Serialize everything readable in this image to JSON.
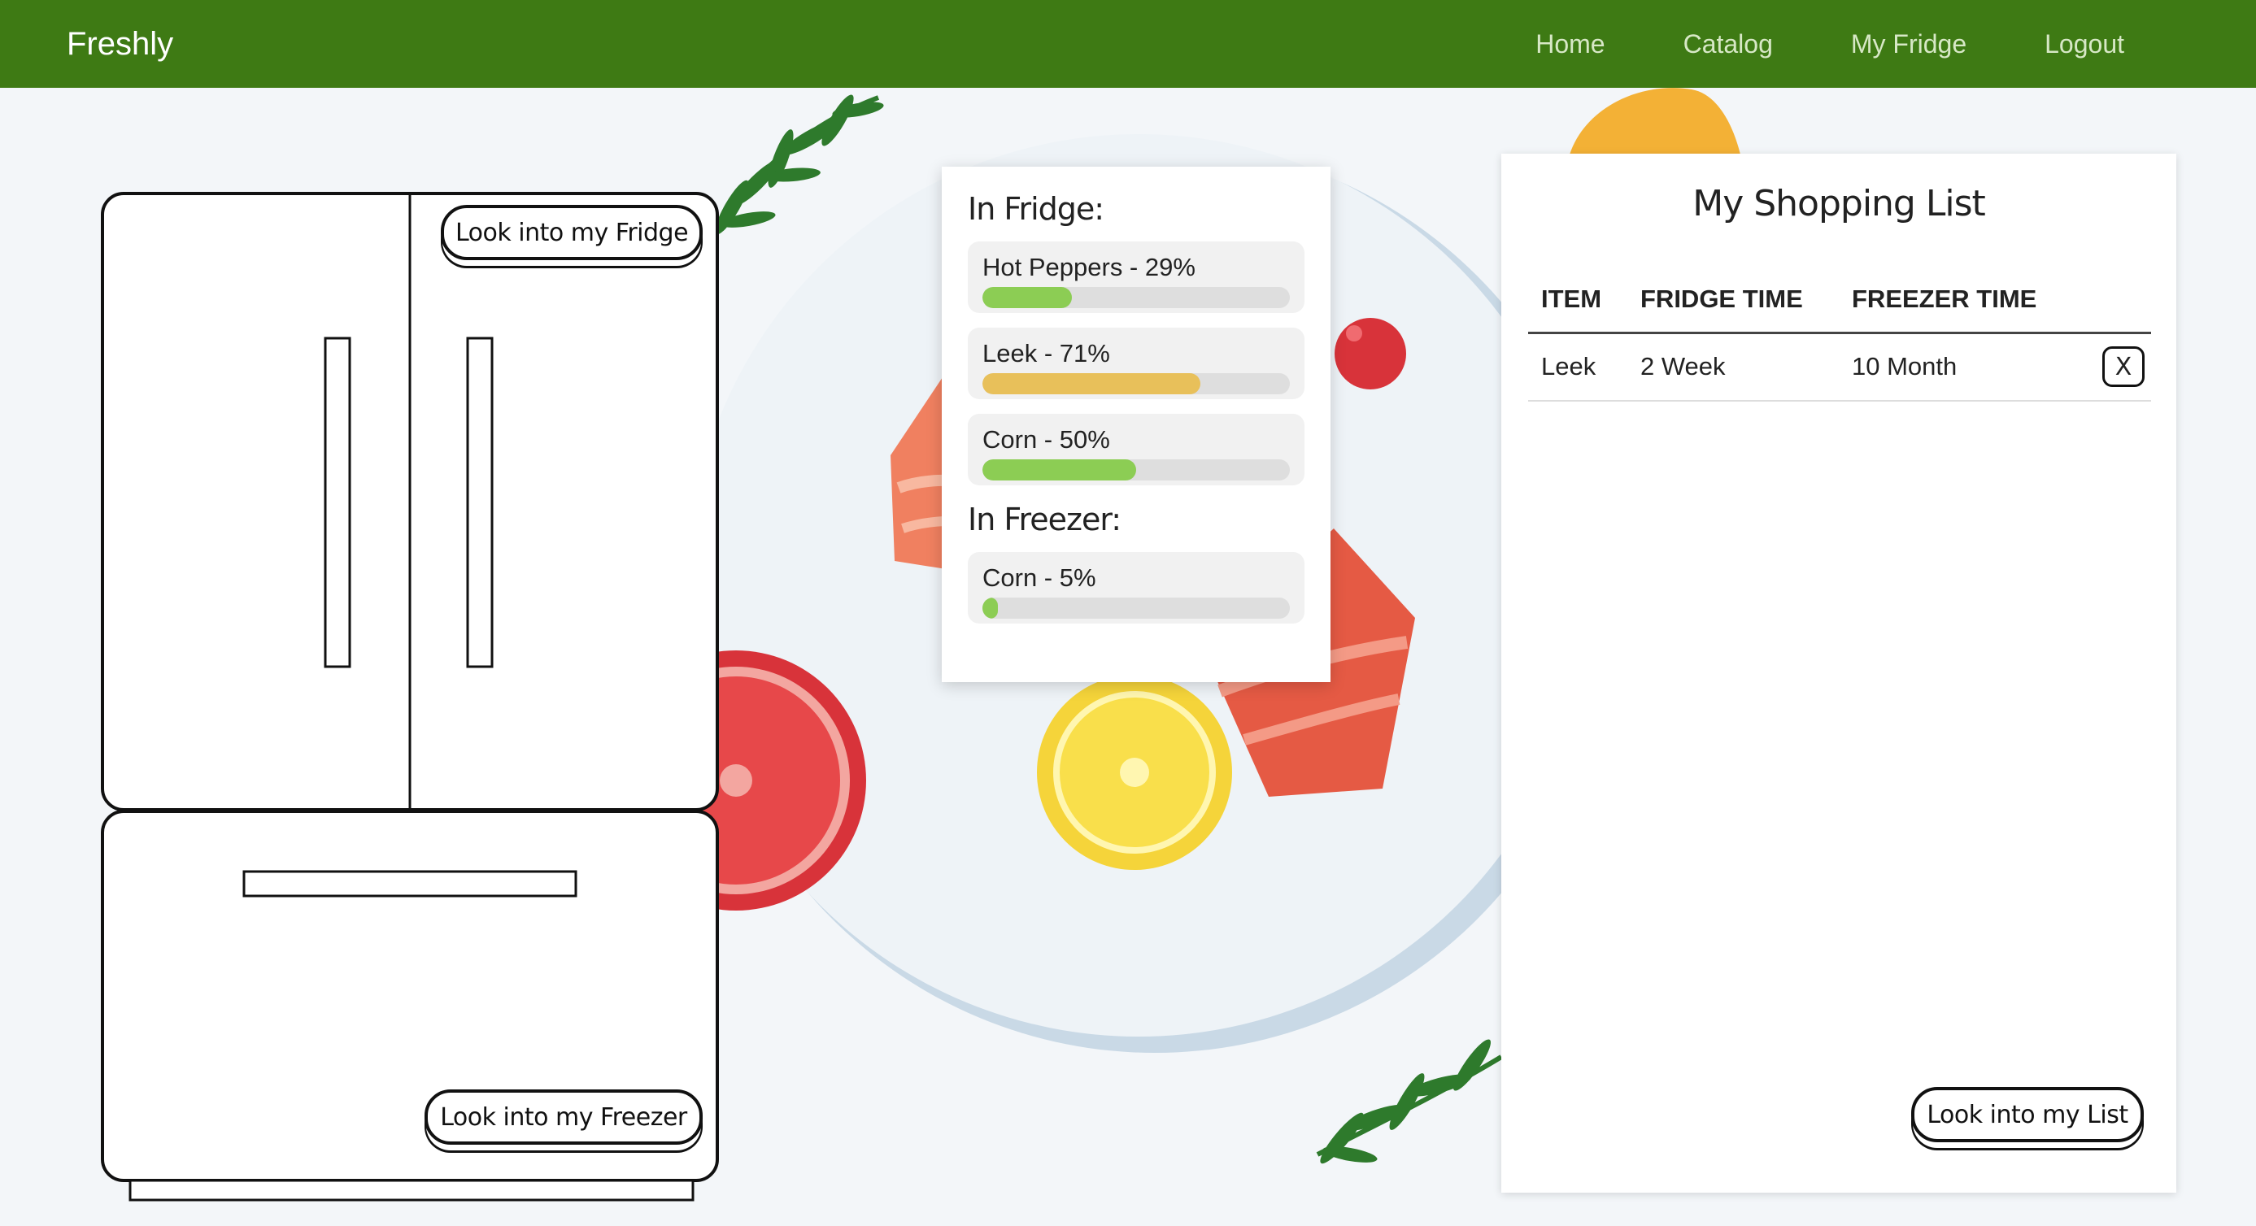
{
  "navbar": {
    "brand": "Freshly",
    "links": [
      "Home",
      "Catalog",
      "My Fridge",
      "Logout"
    ]
  },
  "fridge": {
    "fridge_button": "Look into my Fridge",
    "freezer_button": "Look into my Freezer"
  },
  "stock": {
    "fridge_title": "In Fridge:",
    "fridge_items": [
      {
        "label": "Hot Peppers - 29%",
        "percent": 29,
        "color": "#8ccd54"
      },
      {
        "label": "Leek - 71%",
        "percent": 71,
        "color": "#e8c05a"
      },
      {
        "label": "Corn - 50%",
        "percent": 50,
        "color": "#8ccd54"
      }
    ],
    "freezer_title": "In Freezer:",
    "freezer_items": [
      {
        "label": "Corn - 5%",
        "percent": 5,
        "color": "#8ccd54"
      }
    ]
  },
  "shopping_list": {
    "title": "My Shopping List",
    "headers": [
      "ITEM",
      "FRIDGE TIME",
      "FREEZER TIME"
    ],
    "rows": [
      {
        "item": "Leek",
        "fridge_time": "2 Week",
        "freezer_time": "10 Month",
        "remove_label": "X"
      }
    ],
    "list_button": "Look into my List"
  },
  "colors": {
    "navbar": "#3e7a14",
    "background": "#f3f6f9"
  }
}
